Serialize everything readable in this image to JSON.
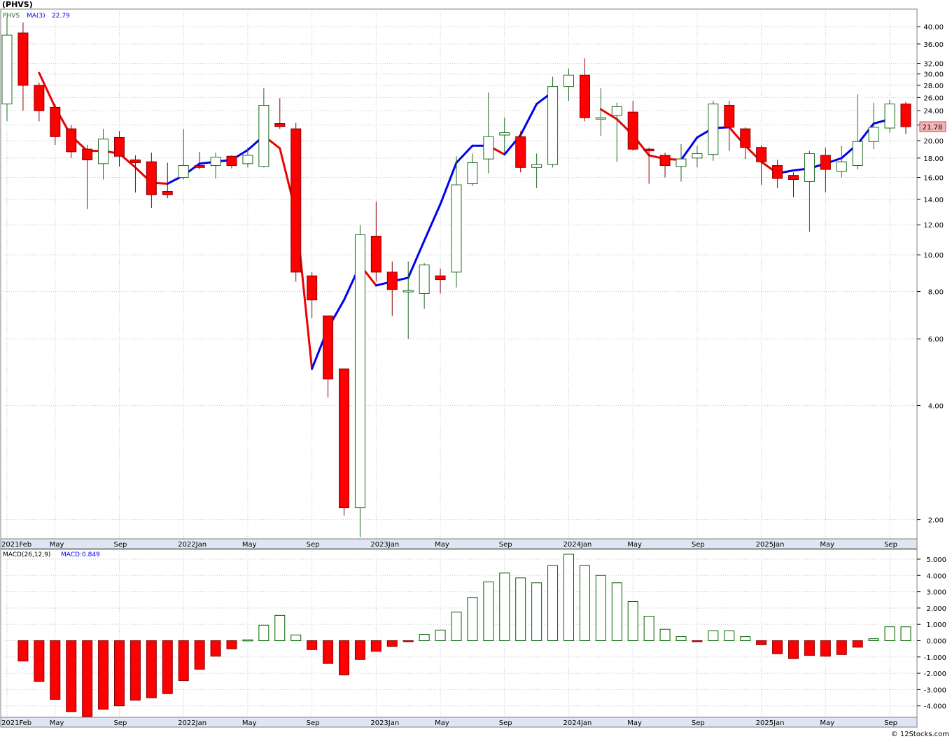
{
  "title": "(PHVS)",
  "watermark": "© 12Stocks.com",
  "colors": {
    "up": "#1f6b1f",
    "down": "#ff0000",
    "ma_up": "#0000ee",
    "ma_down": "#ee0000",
    "macd_up": "#006400",
    "grid": "#c8c8c8"
  },
  "chart_data": [
    {
      "type": "candlestick",
      "scale": "log",
      "ylim": [
        1.78,
        44.5
      ],
      "grid": true,
      "legend": {
        "symbol": "PHVS",
        "ma_label": "MA(3)",
        "ma_value": "22.79"
      },
      "last_price_label": "21.78",
      "yticks": [
        {
          "v": 40,
          "label": "40.00"
        },
        {
          "v": 36,
          "label": "36.00"
        },
        {
          "v": 32,
          "label": "32.00"
        },
        {
          "v": 30,
          "label": "30.00"
        },
        {
          "v": 28,
          "label": "28.00"
        },
        {
          "v": 26,
          "label": "26.00"
        },
        {
          "v": 24,
          "label": "24.00"
        },
        {
          "v": 22,
          "label": "22.00"
        },
        {
          "v": 20,
          "label": "20.00"
        },
        {
          "v": 18,
          "label": "18.00"
        },
        {
          "v": 16,
          "label": "16.00"
        },
        {
          "v": 14,
          "label": "14.00"
        },
        {
          "v": 12,
          "label": "12.00"
        },
        {
          "v": 10,
          "label": "10.00"
        },
        {
          "v": 8,
          "label": "8.00"
        },
        {
          "v": 6,
          "label": "6.00"
        },
        {
          "v": 4,
          "label": "4.00"
        },
        {
          "v": 2,
          "label": "2.00"
        }
      ],
      "x_labels": [
        {
          "i": 0,
          "label": "2021Feb"
        },
        {
          "i": 3,
          "label": "May"
        },
        {
          "i": 7,
          "label": "Sep"
        },
        {
          "i": 11,
          "label": "2022Jan"
        },
        {
          "i": 15,
          "label": "May"
        },
        {
          "i": 19,
          "label": "Sep"
        },
        {
          "i": 23,
          "label": "2023Jan"
        },
        {
          "i": 27,
          "label": "May"
        },
        {
          "i": 31,
          "label": "Sep"
        },
        {
          "i": 35,
          "label": "2024Jan"
        },
        {
          "i": 39,
          "label": "May"
        },
        {
          "i": 43,
          "label": "Sep"
        },
        {
          "i": 47,
          "label": "2025Jan"
        },
        {
          "i": 51,
          "label": "May"
        },
        {
          "i": 55,
          "label": "Sep"
        }
      ],
      "candles": [
        {
          "o": 25.0,
          "h": 42.5,
          "l": 22.5,
          "c": 38.0
        },
        {
          "o": 38.5,
          "h": 41.0,
          "l": 24.0,
          "c": 28.0
        },
        {
          "o": 28.0,
          "h": 28.5,
          "l": 22.5,
          "c": 24.0
        },
        {
          "o": 24.5,
          "h": 25.0,
          "l": 19.5,
          "c": 20.5
        },
        {
          "o": 21.5,
          "h": 22.0,
          "l": 18.0,
          "c": 18.7
        },
        {
          "o": 19.0,
          "h": 19.5,
          "l": 13.2,
          "c": 17.8
        },
        {
          "o": 17.4,
          "h": 21.5,
          "l": 15.8,
          "c": 20.2
        },
        {
          "o": 20.4,
          "h": 21.2,
          "l": 17.1,
          "c": 18.2
        },
        {
          "o": 17.8,
          "h": 18.3,
          "l": 14.6,
          "c": 17.5
        },
        {
          "o": 17.6,
          "h": 18.6,
          "l": 13.3,
          "c": 14.4
        },
        {
          "o": 14.7,
          "h": 17.5,
          "l": 14.1,
          "c": 14.4
        },
        {
          "o": 16.0,
          "h": 21.5,
          "l": 15.8,
          "c": 17.2
        },
        {
          "o": 17.2,
          "h": 18.7,
          "l": 16.8,
          "c": 17.0
        },
        {
          "o": 17.2,
          "h": 18.6,
          "l": 15.9,
          "c": 18.1
        },
        {
          "o": 18.2,
          "h": 18.3,
          "l": 16.9,
          "c": 17.2
        },
        {
          "o": 17.4,
          "h": 19.2,
          "l": 17.0,
          "c": 18.3
        },
        {
          "o": 17.1,
          "h": 27.5,
          "l": 17.0,
          "c": 24.8
        },
        {
          "o": 22.2,
          "h": 25.9,
          "l": 21.5,
          "c": 21.8
        },
        {
          "o": 21.5,
          "h": 22.3,
          "l": 8.5,
          "c": 9.0
        },
        {
          "o": 8.8,
          "h": 9.0,
          "l": 6.8,
          "c": 7.6
        },
        {
          "o": 6.9,
          "h": 6.9,
          "l": 4.2,
          "c": 4.7
        },
        {
          "o": 5.0,
          "h": 5.0,
          "l": 2.05,
          "c": 2.15
        },
        {
          "o": 2.15,
          "h": 12.0,
          "l": 1.8,
          "c": 11.3
        },
        {
          "o": 11.2,
          "h": 13.8,
          "l": 8.5,
          "c": 9.0
        },
        {
          "o": 9.0,
          "h": 9.6,
          "l": 6.9,
          "c": 8.1
        },
        {
          "o": 8.05,
          "h": 9.6,
          "l": 6.0,
          "c": 8.05
        },
        {
          "o": 7.9,
          "h": 9.5,
          "l": 7.2,
          "c": 9.4
        },
        {
          "o": 8.8,
          "h": 9.2,
          "l": 7.9,
          "c": 8.6
        },
        {
          "o": 9.0,
          "h": 18.2,
          "l": 8.2,
          "c": 15.3
        },
        {
          "o": 15.4,
          "h": 18.5,
          "l": 15.2,
          "c": 17.5
        },
        {
          "o": 17.9,
          "h": 26.8,
          "l": 16.4,
          "c": 20.5
        },
        {
          "o": 20.7,
          "h": 23.0,
          "l": 18.5,
          "c": 21.0
        },
        {
          "o": 20.5,
          "h": 21.2,
          "l": 16.5,
          "c": 17.0
        },
        {
          "o": 17.0,
          "h": 18.5,
          "l": 15.0,
          "c": 17.3
        },
        {
          "o": 17.3,
          "h": 29.5,
          "l": 17.0,
          "c": 27.8
        },
        {
          "o": 27.8,
          "h": 31.0,
          "l": 25.5,
          "c": 29.8
        },
        {
          "o": 29.8,
          "h": 33.0,
          "l": 22.5,
          "c": 23.0
        },
        {
          "o": 23.0,
          "h": 27.5,
          "l": 20.6,
          "c": 23.0
        },
        {
          "o": 23.3,
          "h": 25.2,
          "l": 17.6,
          "c": 24.6
        },
        {
          "o": 23.8,
          "h": 25.5,
          "l": 18.8,
          "c": 19.0
        },
        {
          "o": 19.0,
          "h": 19.2,
          "l": 15.4,
          "c": 18.8
        },
        {
          "o": 18.3,
          "h": 18.6,
          "l": 16.0,
          "c": 17.2
        },
        {
          "o": 17.1,
          "h": 19.6,
          "l": 15.6,
          "c": 17.9
        },
        {
          "o": 18.0,
          "h": 19.4,
          "l": 17.0,
          "c": 18.5
        },
        {
          "o": 18.4,
          "h": 25.5,
          "l": 17.7,
          "c": 25.0
        },
        {
          "o": 24.8,
          "h": 25.5,
          "l": 18.8,
          "c": 21.7
        },
        {
          "o": 21.5,
          "h": 21.7,
          "l": 17.9,
          "c": 19.2
        },
        {
          "o": 19.2,
          "h": 19.5,
          "l": 15.3,
          "c": 17.6
        },
        {
          "o": 17.2,
          "h": 17.8,
          "l": 15.0,
          "c": 15.9
        },
        {
          "o": 16.2,
          "h": 16.5,
          "l": 14.2,
          "c": 15.8
        },
        {
          "o": 15.6,
          "h": 18.8,
          "l": 11.5,
          "c": 18.5
        },
        {
          "o": 18.3,
          "h": 19.2,
          "l": 14.6,
          "c": 16.8
        },
        {
          "o": 16.6,
          "h": 19.4,
          "l": 16.0,
          "c": 17.6
        },
        {
          "o": 17.2,
          "h": 26.5,
          "l": 16.8,
          "c": 19.9
        },
        {
          "o": 19.9,
          "h": 25.2,
          "l": 19.0,
          "c": 21.7
        },
        {
          "o": 21.6,
          "h": 25.6,
          "l": 21.0,
          "c": 25.0
        },
        {
          "o": 25.0,
          "h": 25.3,
          "l": 20.8,
          "c": 21.78
        }
      ],
      "ma": [
        null,
        null,
        30.2,
        24.5,
        20.6,
        18.8,
        18.8,
        18.5,
        17.0,
        15.5,
        15.4,
        16.2,
        17.4,
        17.6,
        17.8,
        18.9,
        20.6,
        19.1,
        12.9,
        5.0,
        6.4,
        7.6,
        9.4,
        8.3,
        8.5,
        8.7,
        10.9,
        13.6,
        17.5,
        19.4,
        19.4,
        18.4,
        20.7,
        25.0,
        26.9,
        null,
        null,
        24.2,
        22.8,
        20.7,
        18.3,
        17.9,
        17.8,
        20.4,
        21.6,
        21.7,
        19.4,
        17.6,
        16.4,
        16.7,
        16.9,
        17.4,
        18.0,
        19.6,
        22.2,
        22.79
      ],
      "ma_colors": [
        "",
        "",
        "down",
        "down",
        "down",
        "down",
        "down",
        "down",
        "down",
        "down",
        "down",
        "up",
        "up",
        "up",
        "up",
        "up",
        "up",
        "down",
        "down",
        "down",
        "up",
        "up",
        "up",
        "down",
        "up",
        "up",
        "up",
        "up",
        "up",
        "up",
        "up",
        "down",
        "up",
        "up",
        "up",
        "",
        "",
        "down",
        "down",
        "down",
        "down",
        "down",
        "down",
        "up",
        "up",
        "up",
        "down",
        "down",
        "down",
        "up",
        "up",
        "up",
        "up",
        "up",
        "up",
        "up"
      ]
    },
    {
      "type": "bar",
      "legend": {
        "label": "MACD(26,12,9)",
        "value_label": "MACD:0.849"
      },
      "ylim": [
        -4.7,
        5.6
      ],
      "grid": true,
      "yticks": [
        {
          "v": 5,
          "label": "5.000"
        },
        {
          "v": 4,
          "label": "4.000"
        },
        {
          "v": 3,
          "label": "3.000"
        },
        {
          "v": 2,
          "label": "2.000"
        },
        {
          "v": 1,
          "label": "1.000"
        },
        {
          "v": 0,
          "label": "0.000"
        },
        {
          "v": -1,
          "label": "-1.000"
        },
        {
          "v": -2,
          "label": "-2.000"
        },
        {
          "v": -3,
          "label": "-3.000"
        },
        {
          "v": -4,
          "label": "-4.000"
        }
      ],
      "x_labels": [
        {
          "i": 0,
          "label": "2021Feb"
        },
        {
          "i": 3,
          "label": "May"
        },
        {
          "i": 7,
          "label": "Sep"
        },
        {
          "i": 11,
          "label": "2022Jan"
        },
        {
          "i": 15,
          "label": "May"
        },
        {
          "i": 19,
          "label": "Sep"
        },
        {
          "i": 23,
          "label": "2023Jan"
        },
        {
          "i": 27,
          "label": "May"
        },
        {
          "i": 31,
          "label": "Sep"
        },
        {
          "i": 35,
          "label": "2024Jan"
        },
        {
          "i": 39,
          "label": "May"
        },
        {
          "i": 43,
          "label": "Sep"
        },
        {
          "i": 47,
          "label": "2025Jan"
        },
        {
          "i": 51,
          "label": "May"
        },
        {
          "i": 55,
          "label": "Sep"
        }
      ],
      "values": [
        null,
        -1.25,
        -2.5,
        -3.6,
        -4.35,
        -4.65,
        -4.2,
        -4.0,
        -3.65,
        -3.5,
        -3.25,
        -2.45,
        -1.75,
        -0.95,
        -0.5,
        0.05,
        0.95,
        1.55,
        0.35,
        -0.55,
        -1.4,
        -2.1,
        -1.15,
        -0.65,
        -0.35,
        -0.05,
        0.38,
        0.65,
        1.75,
        2.65,
        3.6,
        4.15,
        3.85,
        3.55,
        4.6,
        5.3,
        4.6,
        4.0,
        3.55,
        2.4,
        1.5,
        0.7,
        0.25,
        -0.05,
        0.6,
        0.6,
        0.25,
        -0.25,
        -0.8,
        -1.1,
        -0.9,
        -0.95,
        -0.85,
        -0.4,
        0.12,
        0.85,
        0.849
      ]
    }
  ]
}
